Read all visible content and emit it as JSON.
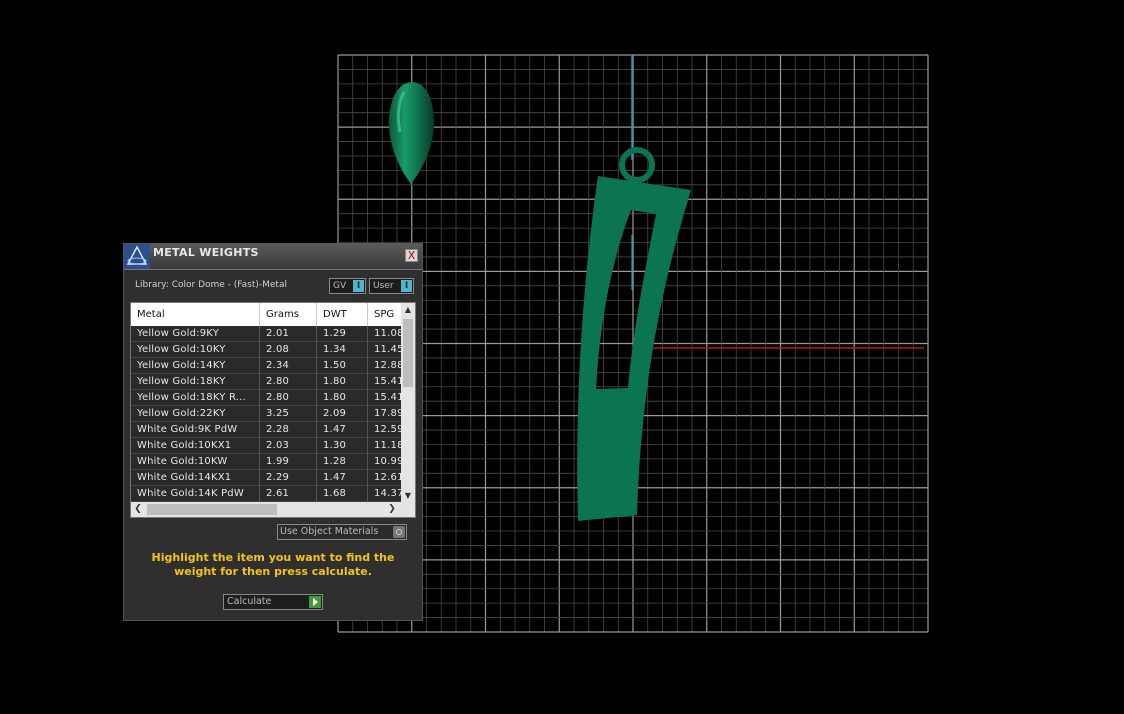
{
  "dialog": {
    "title": "METAL WEIGHTS",
    "close_label": "X",
    "library_label": "Library: Color Dome - (Fast)-Metal",
    "gv_toggle": {
      "label": "GV",
      "knob": "I"
    },
    "user_toggle": {
      "label": "User",
      "knob": "I"
    },
    "table": {
      "columns": [
        "Metal",
        "Grams",
        "DWT",
        "SPG"
      ],
      "rows": [
        [
          "Yellow Gold:9KY",
          "2.01",
          "1.29",
          "11.08"
        ],
        [
          "Yellow Gold:10KY",
          "2.08",
          "1.34",
          "11.45"
        ],
        [
          "Yellow Gold:14KY",
          "2.34",
          "1.50",
          "12.88"
        ],
        [
          "Yellow Gold:18KY",
          "2.80",
          "1.80",
          "15.41"
        ],
        [
          "Yellow Gold:18KY R...",
          "2.80",
          "1.80",
          "15.41"
        ],
        [
          "Yellow Gold:22KY",
          "3.25",
          "2.09",
          "17.89"
        ],
        [
          "White Gold:9K PdW",
          "2.28",
          "1.47",
          "12.59"
        ],
        [
          "White Gold:10KX1",
          "2.03",
          "1.30",
          "11.18"
        ],
        [
          "White Gold:10KW",
          "1.99",
          "1.28",
          "10.99"
        ],
        [
          "White Gold:14KX1",
          "2.29",
          "1.47",
          "12.61"
        ],
        [
          "White Gold:14K PdW",
          "2.61",
          "1.68",
          "14.37"
        ]
      ]
    },
    "use_object_materials": "Use Object Materials",
    "hint": "Highlight the item you want to find the weight for then press calculate.",
    "calculate_label": "Calculate"
  },
  "colors": {
    "model_green": "#0a7550",
    "grid": "#8a8a8a",
    "axis_red": "#b81818",
    "axis_cyan": "#1aa0b0",
    "hint_yellow": "#f2c41a"
  }
}
